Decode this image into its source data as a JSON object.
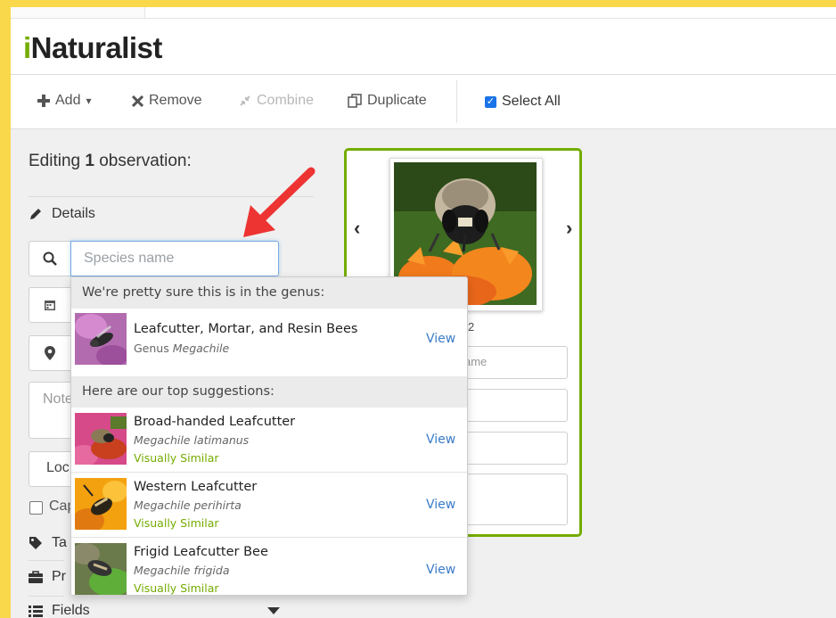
{
  "app": {
    "logo_i": "i",
    "logo_rest": "Naturalist"
  },
  "toolbar": {
    "add": {
      "icon": "plus-icon",
      "label": "Add",
      "caret": "▾"
    },
    "remove": {
      "icon": "times-icon",
      "label": "Remove"
    },
    "combine": {
      "icon": "compress-icon",
      "label": "Combine"
    },
    "duplicate": {
      "icon": "copy-icon",
      "label": "Duplicate"
    },
    "select_all": {
      "label": "Select All",
      "checked": true
    }
  },
  "editor": {
    "editing_prefix": "Editing ",
    "editing_count": "1",
    "editing_suffix": " observation:",
    "details_label": "Details",
    "species_placeholder": "Species name",
    "notes_fragment": "Note",
    "location_fragment": "Loc",
    "captive_fragment": "Cap",
    "tags_fragment": "Ta",
    "projects_fragment": "Pr",
    "fields_label": "Fields"
  },
  "photo_card": {
    "counter_fragment": "2",
    "name_fragment": "ame",
    "prev_icon": "chevron-left-icon",
    "next_icon": "chevron-right-icon"
  },
  "suggestions": {
    "genus_header": "We're pretty sure this is in the genus:",
    "top_header": "Here are our top suggestions:",
    "view_label": "View",
    "visually_similar_label": "Visually Similar",
    "genus": {
      "common_name": "Leafcutter, Mortar, and Resin Bees",
      "rank": "Genus",
      "scientific_name": "Megachile"
    },
    "items": [
      {
        "common_name": "Broad-handed Leafcutter",
        "scientific_name": "Megachile latimanus"
      },
      {
        "common_name": "Western Leafcutter",
        "scientific_name": "Megachile perihirta"
      },
      {
        "common_name": "Frigid Leafcutter Bee",
        "scientific_name": "Megachile frigida"
      }
    ]
  },
  "colors": {
    "brand_green": "#74ac00",
    "link_blue": "#3a7bc8",
    "annotation_red": "#ee3333",
    "page_border": "#f9d84b"
  }
}
